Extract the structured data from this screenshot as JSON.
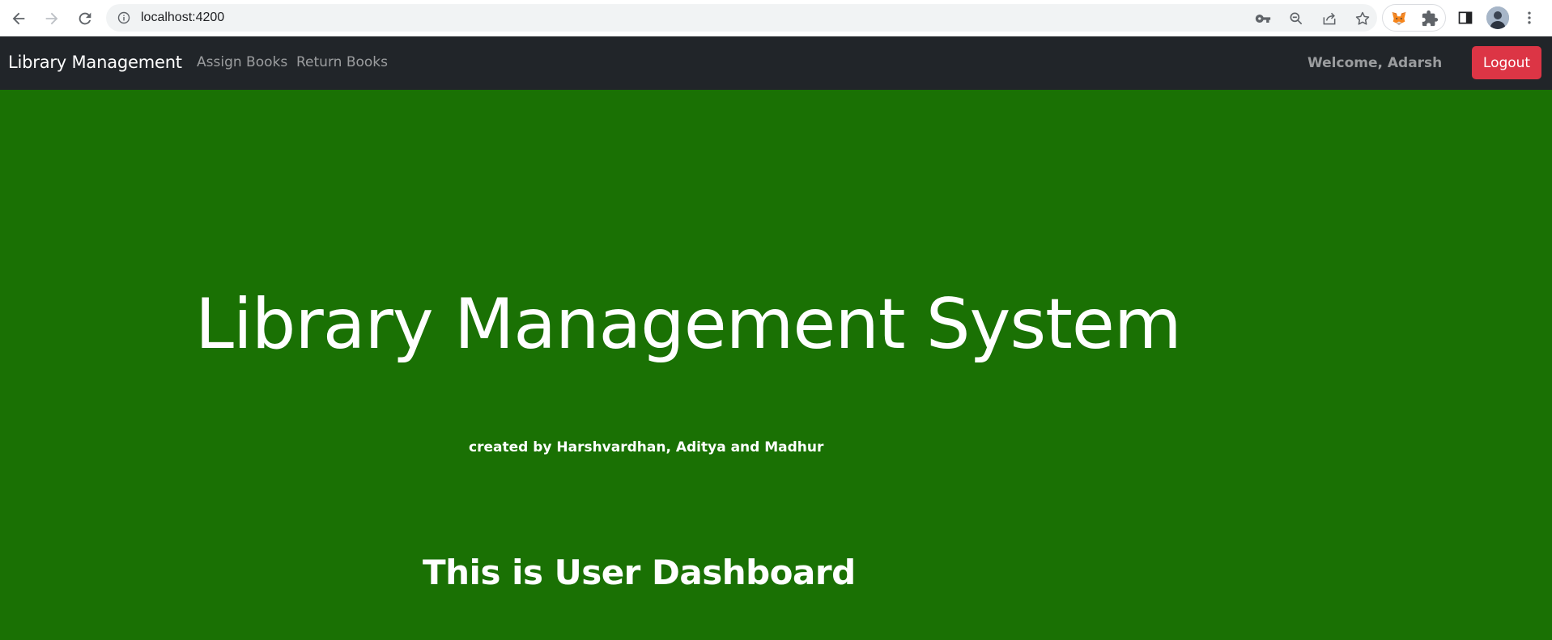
{
  "browser": {
    "url": "localhost:4200",
    "icons": {
      "back": "back-arrow-icon",
      "forward": "forward-arrow-icon",
      "reload": "reload-icon",
      "site_info": "info-icon",
      "password": "key-icon",
      "zoom": "zoom-out-icon",
      "share": "share-icon",
      "bookmark": "star-icon",
      "extension_metamask": "metamask-fox-icon",
      "extensions": "puzzle-icon",
      "side_panel": "side-panel-icon",
      "profile": "avatar",
      "menu": "kebab-menu-icon"
    }
  },
  "navbar": {
    "brand": "Library Management",
    "links": [
      "Assign Books",
      "Return Books"
    ],
    "welcome": "Welcome, Adarsh",
    "logout_label": "Logout"
  },
  "hero": {
    "title": "Library Management System",
    "credit": "created by Harshvardhan, Aditya and Madhur",
    "dashboard_heading": "This is User Dashboard"
  },
  "colors": {
    "navbar_bg": "#212529",
    "hero_bg": "#1a7104",
    "logout_bg": "#dc3545"
  }
}
